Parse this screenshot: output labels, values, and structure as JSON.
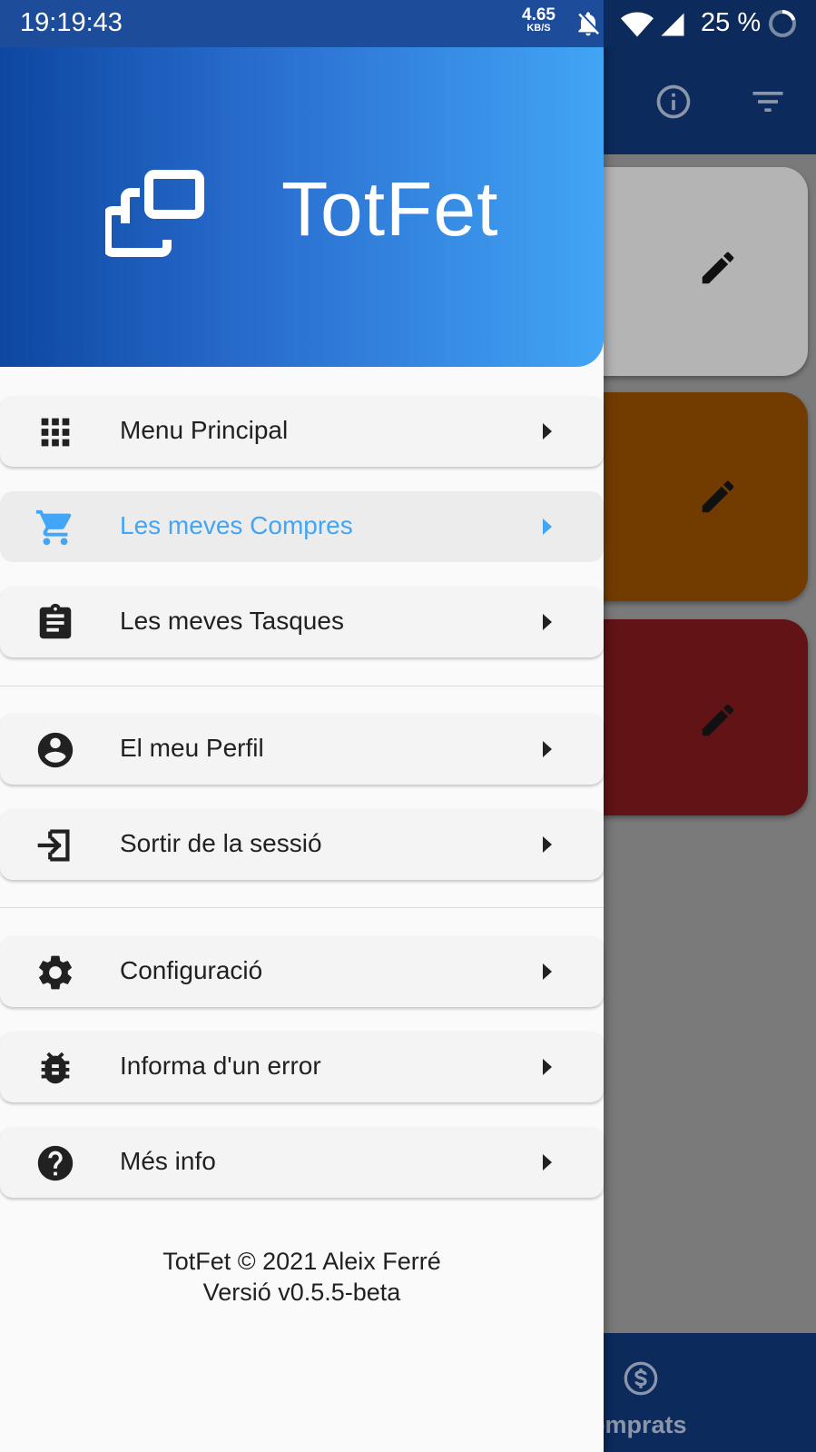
{
  "status_bar": {
    "time": "19:19:43",
    "speed_value": "4.65",
    "speed_unit": "KB/S",
    "battery": "25 %",
    "icons": [
      "bell-off-icon",
      "wifi-icon",
      "signal-icon",
      "battery-ring-icon"
    ]
  },
  "drawer": {
    "header": {
      "logo_icon": "stacked-cards-logo",
      "title": "TotFet",
      "gradient": [
        "#0d47a1",
        "#42a5f5"
      ]
    },
    "groups": [
      [
        {
          "label": "Menu Principal",
          "icon": "grid-icon",
          "active": false
        },
        {
          "label": "Les meves Compres",
          "icon": "cart-icon",
          "active": true
        },
        {
          "label": "Les meves Tasques",
          "icon": "clipboard-icon",
          "active": false
        }
      ],
      [
        {
          "label": "El meu Perfil",
          "icon": "account-circle-icon",
          "active": false
        },
        {
          "label": "Sortir de la sessió",
          "icon": "exit-icon",
          "active": false
        }
      ],
      [
        {
          "label": "Configuració",
          "icon": "gear-icon",
          "active": false
        },
        {
          "label": "Informa d'un error",
          "icon": "bug-icon",
          "active": false
        },
        {
          "label": "Més info",
          "icon": "help-icon",
          "active": false
        }
      ]
    ],
    "footer": {
      "line1": "TotFet © 2021 Aleix Ferré",
      "line2": "Versió v0.5.5-beta"
    },
    "active_color": "#42a5f5"
  },
  "background": {
    "appbar_icons": [
      "info-icon",
      "filter-icon"
    ],
    "cards": [
      {
        "color": "#b4b4b4",
        "icon": "pencil-icon"
      },
      {
        "color": "#723c00",
        "icon": "pencil-icon"
      },
      {
        "color": "#611315",
        "icon": "pencil-icon"
      }
    ],
    "bottom_nav_label": "omprats",
    "bottom_nav_icon": "dollar-icon"
  }
}
